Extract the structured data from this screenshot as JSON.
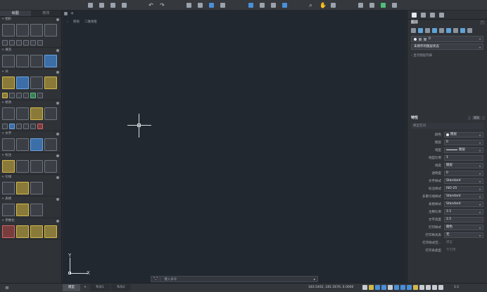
{
  "toolbar": {
    "icons": [
      "new-file-icon",
      "open-folder-icon",
      "save-icon",
      "save-as-icon",
      "undo-icon",
      "redo-icon",
      "print-icon",
      "plot-preview-icon",
      "publish-icon",
      "print-setup-icon",
      "copy-icon",
      "paste-icon",
      "match-properties-icon",
      "block-editor-icon",
      "zoom-search-icon",
      "pan-hand-icon",
      "zoom-window-icon",
      "insert-icon",
      "attach-icon",
      "checklist-icon",
      "export-icon"
    ]
  },
  "left_panel": {
    "tabs": [
      "绘图",
      "修改"
    ],
    "groups": [
      "图形",
      "填充",
      "块",
      "修改",
      "文字",
      "标注",
      "引线",
      "表格",
      "参数化"
    ]
  },
  "canvas": {
    "breadcrumb": [
      "俯视",
      "二维线框"
    ],
    "ucs_x": "X",
    "ucs_y": "Y",
    "command_button": "\"_\"",
    "command_placeholder": "键入命令"
  },
  "layers": {
    "title": "图层",
    "current_layer": "0",
    "layer_state": "未保存的图层状态",
    "show_list": "显示图层列表"
  },
  "properties": {
    "title": "特性",
    "buttons": [
      "",
      "隔离",
      ""
    ],
    "scope": "模型空间",
    "rows": [
      {
        "label": "颜色",
        "value": "随层",
        "kind": "swatch"
      },
      {
        "label": "图层",
        "value": "0",
        "kind": "select"
      },
      {
        "label": "线型",
        "value": "随层",
        "kind": "line"
      },
      {
        "label": "线型比例",
        "value": "1",
        "kind": "text"
      },
      {
        "label": "线宽",
        "value": "随层",
        "kind": "select"
      },
      {
        "label": "透明度",
        "value": "0",
        "kind": "select"
      },
      {
        "label": "文字样式",
        "value": "Standard",
        "kind": "select"
      },
      {
        "label": "标注样式",
        "value": "ISO-25",
        "kind": "select"
      },
      {
        "label": "多重引线样式",
        "value": "Standard",
        "kind": "select"
      },
      {
        "label": "表格样式",
        "value": "Standard",
        "kind": "select"
      },
      {
        "label": "注释比例",
        "value": "1:1",
        "kind": "select"
      },
      {
        "label": "文字高度",
        "value": "2.5",
        "kind": "text"
      },
      {
        "label": "打印样式",
        "value": "随色",
        "kind": "select"
      },
      {
        "label": "打印样式表",
        "value": "无",
        "kind": "select"
      },
      {
        "label": "打印样式空...",
        "value": "模型",
        "kind": "dim"
      },
      {
        "label": "打印表类型",
        "value": "不可用",
        "kind": "dim"
      }
    ]
  },
  "status": {
    "tabs": [
      "模型",
      "布局1",
      "布局2"
    ],
    "active_tab": 0,
    "coords": "183.5402, 181.5676, 0.0000",
    "scale": "1:1"
  }
}
